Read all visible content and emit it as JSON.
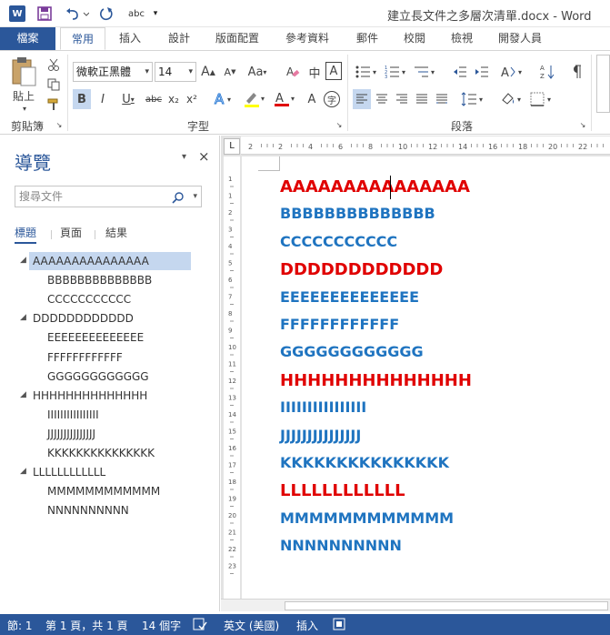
{
  "window": {
    "title": "建立長文件之多層次清單.docx - Word",
    "logo": "W"
  },
  "quick_access": {
    "save_icon": "floppy-icon",
    "undo_icon": "undo-icon",
    "redo_icon": "repeat-icon",
    "spell": "abc"
  },
  "tabs": {
    "file": "檔案",
    "home": "常用",
    "insert": "插入",
    "design": "設計",
    "layout": "版面配置",
    "references": "參考資料",
    "mailings": "郵件",
    "review": "校閱",
    "view": "檢視",
    "developer": "開發人員"
  },
  "ribbon": {
    "clipboard": {
      "label": "剪貼簿",
      "paste": "貼上"
    },
    "font": {
      "label": "字型",
      "font_name": "微軟正黑體",
      "font_size": "14",
      "case_btn": "Aa",
      "bold": "B",
      "italic": "I",
      "underline": "U",
      "strike": "abc",
      "sub": "x₂",
      "sup": "x²",
      "grow": "A",
      "shrink": "A",
      "phonetic": "中",
      "enclose": "字",
      "border_char": "A"
    },
    "paragraph": {
      "label": "段落"
    }
  },
  "nav": {
    "title": "導覽",
    "search_placeholder": "搜尋文件",
    "tabs": [
      "標題",
      "頁面",
      "結果"
    ],
    "items": [
      {
        "text": "AAAAAAAAAAAAAAA",
        "level": 1,
        "selected": true
      },
      {
        "text": "BBBBBBBBBBBBBB",
        "level": 2
      },
      {
        "text": "CCCCCCCCCCC",
        "level": 2
      },
      {
        "text": "DDDDDDDDDDDD",
        "level": 1
      },
      {
        "text": "EEEEEEEEEEEEEE",
        "level": 2
      },
      {
        "text": "FFFFFFFFFFFF",
        "level": 2
      },
      {
        "text": "GGGGGGGGGGGG",
        "level": 2
      },
      {
        "text": "HHHHHHHHHHHHHH",
        "level": 1
      },
      {
        "text": "IIIIIIIIIIIIIIII",
        "level": 2
      },
      {
        "text": "JJJJJJJJJJJJJJJ",
        "level": 2
      },
      {
        "text": "KKKKKKKKKKKKKKK",
        "level": 2
      },
      {
        "text": "LLLLLLLLLLLL",
        "level": 1
      },
      {
        "text": "MMMMMMMMMMMM",
        "level": 2
      },
      {
        "text": "NNNNNNNNNN",
        "level": 2
      }
    ]
  },
  "document": {
    "lines": [
      {
        "text": "AAAAAAAAAAAAAAA",
        "color": "#e00000"
      },
      {
        "text": "BBBBBBBBBBBBBB",
        "color": "#1f74c0"
      },
      {
        "text": "CCCCCCCCCCC",
        "color": "#1f74c0"
      },
      {
        "text": "DDDDDDDDDDDD",
        "color": "#e00000"
      },
      {
        "text": "EEEEEEEEEEEEEE",
        "color": "#1f74c0"
      },
      {
        "text": "FFFFFFFFFFFF",
        "color": "#1f74c0"
      },
      {
        "text": "GGGGGGGGGGGG",
        "color": "#1f74c0"
      },
      {
        "text": "HHHHHHHHHHHHHH",
        "color": "#e00000"
      },
      {
        "text": "IIIIIIIIIIIIIIII",
        "color": "#1f74c0"
      },
      {
        "text": "JJJJJJJJJJJJJJJ",
        "color": "#1f74c0"
      },
      {
        "text": "KKKKKKKKKKKKKKK",
        "color": "#1f74c0"
      },
      {
        "text": "LLLLLLLLLLLL",
        "color": "#e00000"
      },
      {
        "text": "MMMMMMMMMMMM",
        "color": "#1f74c0"
      },
      {
        "text": "NNNNNNNNNN",
        "color": "#1f74c0"
      }
    ]
  },
  "ruler": {
    "h_ticks": [
      "2",
      "2",
      "4",
      "6",
      "8",
      "10",
      "12",
      "14",
      "16",
      "18",
      "20",
      "22"
    ],
    "v_ticks": [
      "1",
      "1",
      "2",
      "3",
      "4",
      "5",
      "6",
      "7",
      "8",
      "9",
      "10",
      "11",
      "12",
      "13",
      "14",
      "15",
      "16",
      "17",
      "18",
      "19",
      "20",
      "21",
      "22",
      "23"
    ],
    "corner": "L"
  },
  "status": {
    "section": "節: 1",
    "page": "第 1 頁，共 1 頁",
    "words": "14 個字",
    "lang": "英文 (美國)",
    "mode": "插入"
  },
  "colors": {
    "accent": "#2b579a",
    "heading1": "#e00000",
    "heading2": "#1f74c0"
  }
}
